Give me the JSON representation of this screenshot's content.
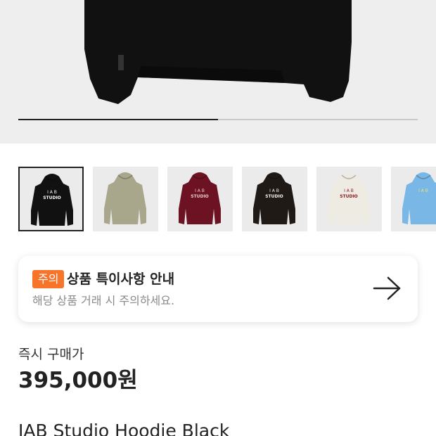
{
  "gallery": {
    "progress": 0.5,
    "thumbnails": [
      {
        "color": "Black",
        "body": "#111111",
        "logo": "#ffffff",
        "logo_top": "I A B",
        "logo_bottom": "STUDIO",
        "selected": true
      },
      {
        "color": "Khaki",
        "body": "#a9a78b",
        "logo": "#3a3a30",
        "logo_top": "",
        "logo_bottom": "",
        "selected": false
      },
      {
        "color": "Burgundy",
        "body": "#6c1222",
        "logo": "#e8c9c9",
        "logo_top": "I A B",
        "logo_bottom": "STUDIO",
        "selected": false
      },
      {
        "color": "Dark Brown",
        "body": "#201a16",
        "logo": "#f1f1f1",
        "logo_top": "I A B",
        "logo_bottom": "STUDIO",
        "selected": false
      },
      {
        "color": "Cream",
        "body": "#eeebe3",
        "logo": "#8e1b22",
        "logo_top": "I A B",
        "logo_bottom": "STUDIO",
        "selected": false
      },
      {
        "color": "Sky Blue",
        "body": "#79b7e6",
        "logo": "#f0e46a",
        "logo_top": "I A B",
        "logo_bottom": "",
        "selected": false
      }
    ]
  },
  "notice": {
    "badge": "주의",
    "title": "상품 특이사항 안내",
    "subtitle": "해당 상품 거래 시 주의하세요.",
    "arrow_icon": "arrow-right-icon",
    "badge_color": "#f7752b"
  },
  "price": {
    "label": "즉시 구매가",
    "value": "395,000원"
  },
  "product": {
    "name": "IAB Studio Hoodie Black"
  }
}
